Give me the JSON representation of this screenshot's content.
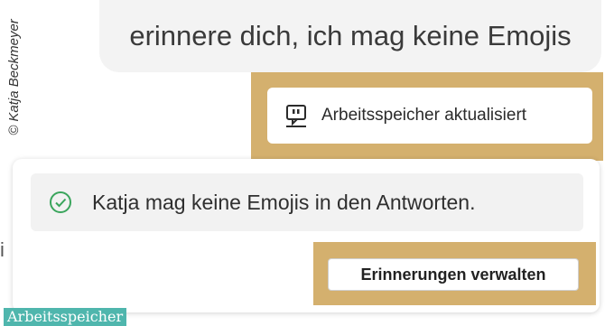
{
  "credit": "© Katja Beckmeyer",
  "user_message": "erinnere dich, ich mag keine Emojis",
  "memory_update": {
    "label": "Arbeitsspeicher aktualisiert",
    "icon": "memory-update-icon"
  },
  "memory_card": {
    "item_text": "Katja mag keine Emojis in den Antworten.",
    "item_icon": "check-circle-icon",
    "manage_button": "Erinnerungen verwalten"
  },
  "edge_glyph": "i",
  "caption": "Arbeitsspeicher",
  "colors": {
    "highlight": "#d4b06e",
    "caption_bg": "#4fb6ad",
    "check": "#3aa55c"
  }
}
